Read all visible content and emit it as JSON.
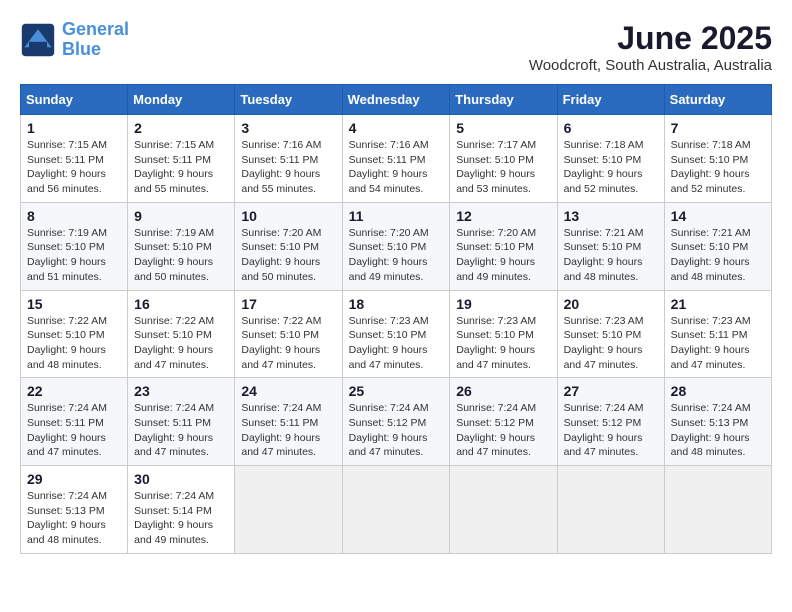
{
  "logo": {
    "line1": "General",
    "line2": "Blue"
  },
  "title": "June 2025",
  "location": "Woodcroft, South Australia, Australia",
  "days_of_week": [
    "Sunday",
    "Monday",
    "Tuesday",
    "Wednesday",
    "Thursday",
    "Friday",
    "Saturday"
  ],
  "weeks": [
    [
      {
        "day": "1",
        "sunrise": "7:15 AM",
        "sunset": "5:11 PM",
        "daylight": "9 hours and 56 minutes."
      },
      {
        "day": "2",
        "sunrise": "7:15 AM",
        "sunset": "5:11 PM",
        "daylight": "9 hours and 55 minutes."
      },
      {
        "day": "3",
        "sunrise": "7:16 AM",
        "sunset": "5:11 PM",
        "daylight": "9 hours and 55 minutes."
      },
      {
        "day": "4",
        "sunrise": "7:16 AM",
        "sunset": "5:11 PM",
        "daylight": "9 hours and 54 minutes."
      },
      {
        "day": "5",
        "sunrise": "7:17 AM",
        "sunset": "5:10 PM",
        "daylight": "9 hours and 53 minutes."
      },
      {
        "day": "6",
        "sunrise": "7:18 AM",
        "sunset": "5:10 PM",
        "daylight": "9 hours and 52 minutes."
      },
      {
        "day": "7",
        "sunrise": "7:18 AM",
        "sunset": "5:10 PM",
        "daylight": "9 hours and 52 minutes."
      }
    ],
    [
      {
        "day": "8",
        "sunrise": "7:19 AM",
        "sunset": "5:10 PM",
        "daylight": "9 hours and 51 minutes."
      },
      {
        "day": "9",
        "sunrise": "7:19 AM",
        "sunset": "5:10 PM",
        "daylight": "9 hours and 50 minutes."
      },
      {
        "day": "10",
        "sunrise": "7:20 AM",
        "sunset": "5:10 PM",
        "daylight": "9 hours and 50 minutes."
      },
      {
        "day": "11",
        "sunrise": "7:20 AM",
        "sunset": "5:10 PM",
        "daylight": "9 hours and 49 minutes."
      },
      {
        "day": "12",
        "sunrise": "7:20 AM",
        "sunset": "5:10 PM",
        "daylight": "9 hours and 49 minutes."
      },
      {
        "day": "13",
        "sunrise": "7:21 AM",
        "sunset": "5:10 PM",
        "daylight": "9 hours and 48 minutes."
      },
      {
        "day": "14",
        "sunrise": "7:21 AM",
        "sunset": "5:10 PM",
        "daylight": "9 hours and 48 minutes."
      }
    ],
    [
      {
        "day": "15",
        "sunrise": "7:22 AM",
        "sunset": "5:10 PM",
        "daylight": "9 hours and 48 minutes."
      },
      {
        "day": "16",
        "sunrise": "7:22 AM",
        "sunset": "5:10 PM",
        "daylight": "9 hours and 47 minutes."
      },
      {
        "day": "17",
        "sunrise": "7:22 AM",
        "sunset": "5:10 PM",
        "daylight": "9 hours and 47 minutes."
      },
      {
        "day": "18",
        "sunrise": "7:23 AM",
        "sunset": "5:10 PM",
        "daylight": "9 hours and 47 minutes."
      },
      {
        "day": "19",
        "sunrise": "7:23 AM",
        "sunset": "5:10 PM",
        "daylight": "9 hours and 47 minutes."
      },
      {
        "day": "20",
        "sunrise": "7:23 AM",
        "sunset": "5:10 PM",
        "daylight": "9 hours and 47 minutes."
      },
      {
        "day": "21",
        "sunrise": "7:23 AM",
        "sunset": "5:11 PM",
        "daylight": "9 hours and 47 minutes."
      }
    ],
    [
      {
        "day": "22",
        "sunrise": "7:24 AM",
        "sunset": "5:11 PM",
        "daylight": "9 hours and 47 minutes."
      },
      {
        "day": "23",
        "sunrise": "7:24 AM",
        "sunset": "5:11 PM",
        "daylight": "9 hours and 47 minutes."
      },
      {
        "day": "24",
        "sunrise": "7:24 AM",
        "sunset": "5:11 PM",
        "daylight": "9 hours and 47 minutes."
      },
      {
        "day": "25",
        "sunrise": "7:24 AM",
        "sunset": "5:12 PM",
        "daylight": "9 hours and 47 minutes."
      },
      {
        "day": "26",
        "sunrise": "7:24 AM",
        "sunset": "5:12 PM",
        "daylight": "9 hours and 47 minutes."
      },
      {
        "day": "27",
        "sunrise": "7:24 AM",
        "sunset": "5:12 PM",
        "daylight": "9 hours and 47 minutes."
      },
      {
        "day": "28",
        "sunrise": "7:24 AM",
        "sunset": "5:13 PM",
        "daylight": "9 hours and 48 minutes."
      }
    ],
    [
      {
        "day": "29",
        "sunrise": "7:24 AM",
        "sunset": "5:13 PM",
        "daylight": "9 hours and 48 minutes."
      },
      {
        "day": "30",
        "sunrise": "7:24 AM",
        "sunset": "5:14 PM",
        "daylight": "9 hours and 49 minutes."
      },
      null,
      null,
      null,
      null,
      null
    ]
  ]
}
